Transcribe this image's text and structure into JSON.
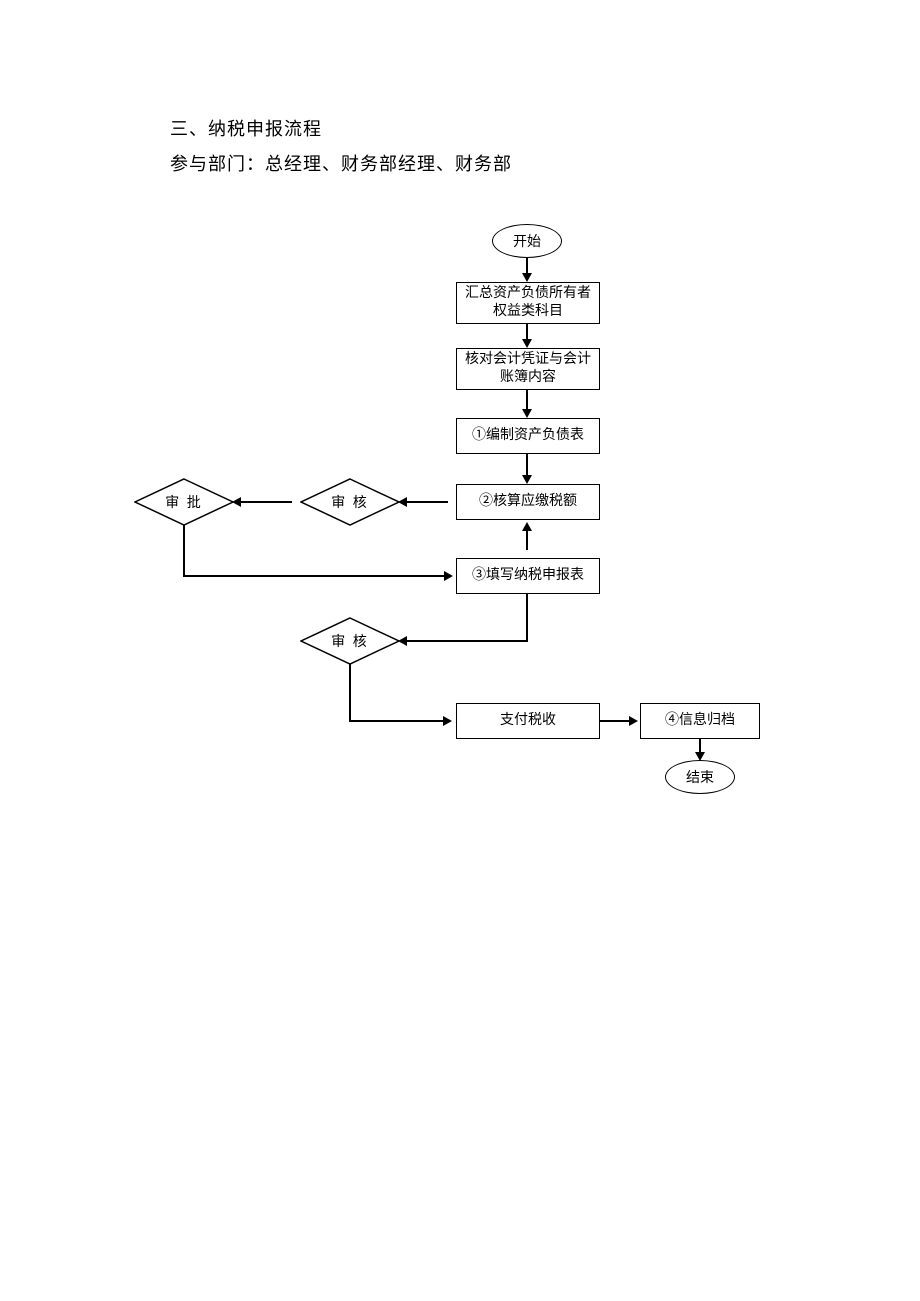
{
  "heading1": "三、纳税申报流程",
  "heading2": "参与部门：总经理、财务部经理、财务部",
  "nodes": {
    "start": "开始",
    "step_summary": "汇总资产负债所有者权益类科目",
    "step_verify": "核对会计凭证与会计账簿内容",
    "step_prepare": "①编制资产负债表",
    "step_calculate": "②核算应缴税额",
    "step_fillform": "③填写纳税申报表",
    "step_pay": "支付税收",
    "step_archive": "④信息归档",
    "end": "结束",
    "review1": "审 核",
    "approve": "审 批",
    "review2": "审 核"
  }
}
